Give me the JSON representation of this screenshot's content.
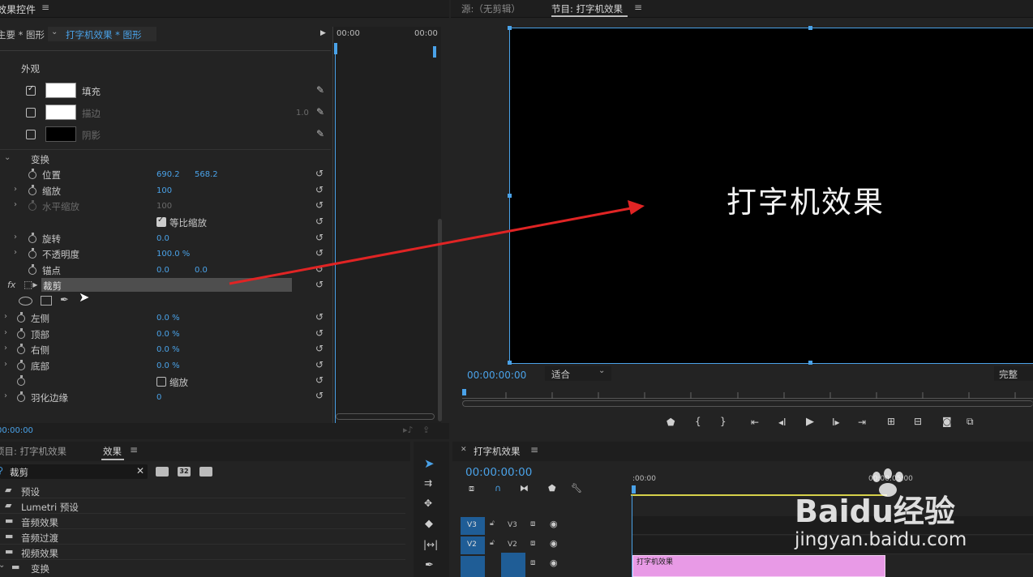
{
  "effect_controls": {
    "panel_title": "效果控件",
    "source_label": "主要 * 图形",
    "clip_label": "打字机效果 * 图形",
    "time_start": "00:00",
    "time_end": "00:00",
    "section_appearance": "外观",
    "fill_label": "填充",
    "stroke_label": "描边",
    "stroke_value": "1.0",
    "shadow_label": "阴影",
    "section_transform": "变换",
    "position_label": "位置",
    "position_x": "690.2",
    "position_y": "568.2",
    "scale_label": "缩放",
    "scale_value": "100",
    "scale_width_label": "水平缩放",
    "scale_width_value": "100",
    "uniform_scale_label": "等比缩放",
    "rotation_label": "旋转",
    "rotation_value": "0.0",
    "opacity_label": "不透明度",
    "opacity_value": "100.0 %",
    "anchor_label": "锚点",
    "anchor_x": "0.0",
    "anchor_y": "0.0",
    "fx_label": "fx",
    "crop_label": "裁剪",
    "left_label": "左侧",
    "left_value": "0.0 %",
    "top_label": "顶部",
    "top_value": "0.0 %",
    "right_label": "右侧",
    "right_value": "0.0 %",
    "bottom_label": "底部",
    "bottom_value": "0.0 %",
    "zoom_label": "缩放",
    "feather_label": "羽化边缘",
    "feather_value": "0",
    "timecode": "00:00:00"
  },
  "source_monitor": {
    "tab_label": "源:（无剪辑）"
  },
  "program_monitor": {
    "tab_label": "节目: 打字机效果",
    "title_text": "打字机效果",
    "timecode": "00:00:00:00",
    "fit_label": "适合",
    "quality_label": "完整"
  },
  "project_panel": {
    "project_tab": "项目: 打字机效果",
    "effects_tab": "效果",
    "search_value": "裁剪",
    "items": [
      "预设",
      "Lumetri 预设",
      "音频效果",
      "音频过渡",
      "视频效果",
      "变换"
    ],
    "badge_32": "32"
  },
  "timeline": {
    "tab_label": "打字机效果",
    "timecode": "00:00:00:00",
    "ruler_start": ":00:00",
    "ruler_mid": "00:00:05:00",
    "tracks": [
      {
        "src": "V3",
        "tgt": "V3"
      },
      {
        "src": "V2",
        "tgt": "V2"
      },
      {
        "src": "",
        "tgt": ""
      }
    ],
    "clip_label": "打字机效果",
    "clip_color": "#e89ae6"
  },
  "watermark": {
    "brand": "Baidu经验",
    "url": "jingyan.baidu.com"
  },
  "colors": {
    "accent": "#4aa2e8",
    "arrow": "#e02424",
    "panel": "#232323",
    "dark": "#1d1d1d"
  }
}
